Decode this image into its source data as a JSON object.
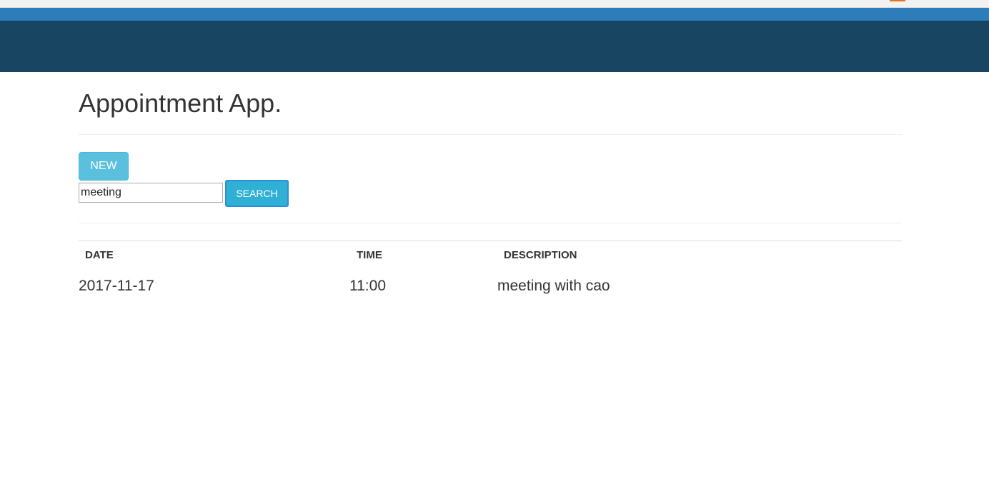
{
  "app": {
    "title": "Appointment App."
  },
  "actions": {
    "new_label": "NEW",
    "search_label": "SEARCH"
  },
  "search": {
    "value": "meeting",
    "placeholder": ""
  },
  "table": {
    "headers": [
      "DATE",
      "TIME",
      "DESCRIPTION"
    ],
    "rows": [
      {
        "date": "2017-11-17",
        "time": "11:00",
        "description": "meeting with cao"
      }
    ]
  },
  "colors": {
    "browser_strip": "#f2f2f2",
    "top_bar": "#2e7dbb",
    "header_band": "#184562",
    "new_button": "#5bc0de",
    "search_button": "#31b0d5"
  }
}
